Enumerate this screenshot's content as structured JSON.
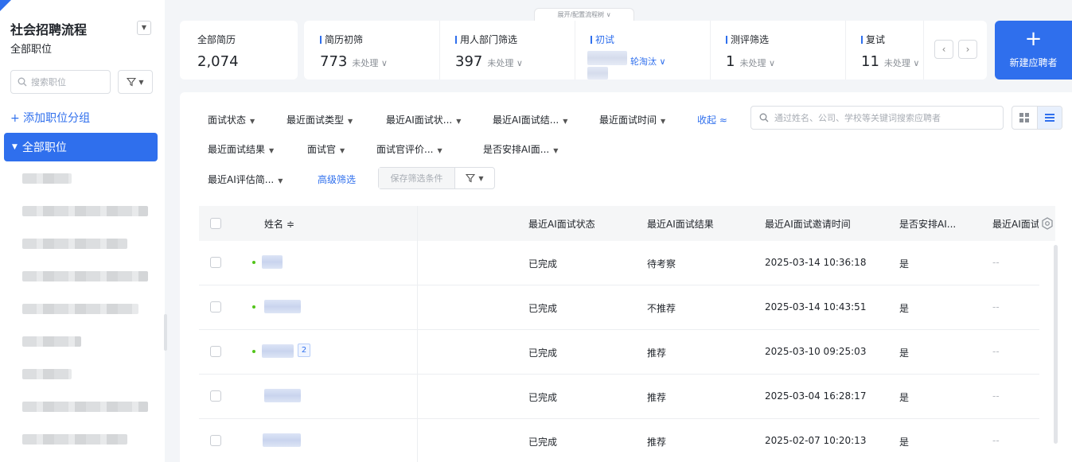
{
  "colors": {
    "accent": "#2f6fed",
    "online": "#52c41a"
  },
  "sidebar": {
    "title": "社会招聘流程",
    "subtitle": "全部职位",
    "search_placeholder": "搜索职位",
    "add_group": "+ 添加职位分组",
    "all_positions": "全部职位"
  },
  "stages": {
    "expand_tab": "展开/配置流程树 ∨",
    "all_resumes": {
      "label": "全部简历",
      "count": "2,074"
    },
    "items": [
      {
        "label": "简历初筛",
        "count": "773",
        "pending": "未处理 ∨"
      },
      {
        "label": "用人部门筛选",
        "count": "397",
        "pending": "未处理 ∨"
      },
      {
        "label": "初试",
        "count": "",
        "pending": "轮淘汰 ∨"
      },
      {
        "label": "测评筛选",
        "count": "1",
        "pending": "未处理 ∨"
      },
      {
        "label": "复试",
        "count": "11",
        "pending": "未处理 ∨"
      }
    ],
    "prev": "‹",
    "next": "›",
    "new_button": {
      "icon": "+",
      "label": "新建应聘者"
    }
  },
  "filters": {
    "row1": [
      "面试状态",
      "最近面试类型",
      "最近AI面试状...",
      "最近AI面试结...",
      "最近面试时间"
    ],
    "collapse": "收起 ≈",
    "row2": [
      "最近面试结果",
      "面试官",
      "面试官评价...",
      "是否安排AI面..."
    ],
    "row3": [
      "最近AI评估简..."
    ],
    "advanced": "高级筛选",
    "save_condition": "保存筛选条件",
    "search_placeholder": "通过姓名、公司、学校等关键词搜索应聘者"
  },
  "table": {
    "headers": {
      "name": "姓名 ≑",
      "ai_status": "最近AI面试状态",
      "ai_result": "最近AI面试结果",
      "ai_invite_time": "最近AI面试邀请时间",
      "ai_arranged": "是否安排AI...",
      "ai_last": "最近AI面试"
    },
    "rows": [
      {
        "status": "已完成",
        "result": "待考察",
        "time": "2025-03-14 10:36:18",
        "arranged": "是",
        "last": "--",
        "badge": ""
      },
      {
        "status": "已完成",
        "result": "不推荐",
        "time": "2025-03-14 10:43:51",
        "arranged": "是",
        "last": "--",
        "badge": ""
      },
      {
        "status": "已完成",
        "result": "推荐",
        "time": "2025-03-10 09:25:03",
        "arranged": "是",
        "last": "--",
        "badge": "2"
      },
      {
        "status": "已完成",
        "result": "推荐",
        "time": "2025-03-04 16:28:17",
        "arranged": "是",
        "last": "--",
        "badge": ""
      },
      {
        "status": "已完成",
        "result": "推荐",
        "time": "2025-02-07 10:20:13",
        "arranged": "是",
        "last": "--",
        "badge": ""
      }
    ]
  }
}
